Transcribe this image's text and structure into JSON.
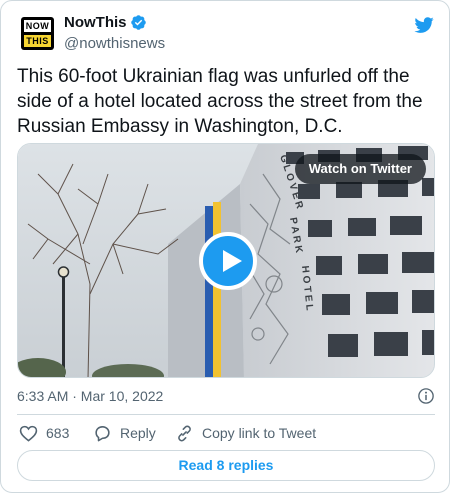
{
  "author": {
    "logo_line1": "NOW",
    "logo_line2": "THIS",
    "display_name": "NowThis",
    "handle": "@nowthisnews",
    "verified": true
  },
  "tweet": {
    "text": "This 60-foot Ukrainian flag was unfurled off the side of a hotel located across the street from the Russian Embassy in Washington, D.C.",
    "timestamp": "6:33 AM · Mar 10, 2022"
  },
  "media": {
    "watch_label": "Watch on Twitter",
    "hotel_sign": "GLOVER PARK HOTEL"
  },
  "actions": {
    "likes_count": "683",
    "reply_label": "Reply",
    "copy_label": "Copy link to Tweet"
  },
  "replies_button": "Read 8 replies",
  "colors": {
    "accent": "#1d9bf0",
    "like_heart": "#536471",
    "flag_blue": "#2a5db0",
    "flag_yellow": "#f2c230"
  },
  "icons": [
    "verified-badge-icon",
    "twitter-bird-icon",
    "play-icon",
    "info-icon",
    "heart-icon",
    "reply-icon",
    "link-icon"
  ]
}
